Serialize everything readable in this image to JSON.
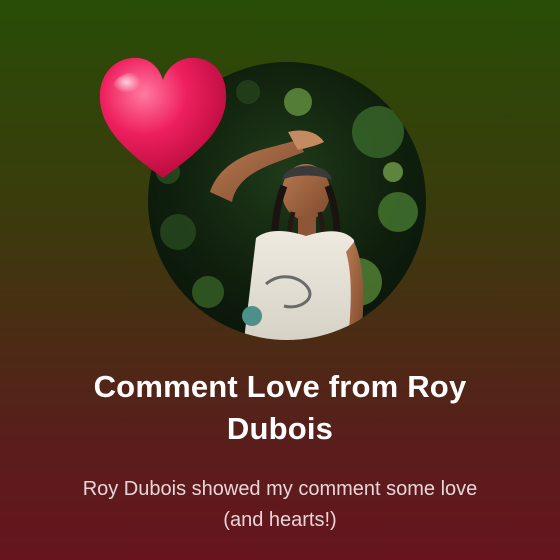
{
  "notification": {
    "title": "Comment Love from Roy Dubois",
    "message": "Roy Dubois showed my comment some love (and hearts!)",
    "avatar_icon": "profile-photo",
    "reaction_icon": "heart-icon"
  },
  "colors": {
    "background_top": "#284d06",
    "background_bottom": "#67141e",
    "heart": "#ec1a5a",
    "title_text": "#ffffff",
    "message_text": "#e6d7d7"
  }
}
